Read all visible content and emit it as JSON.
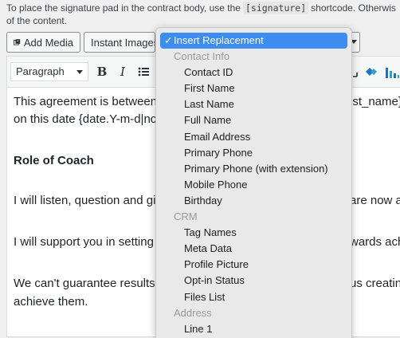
{
  "hint": {
    "before": "To place the signature pad in the contract body, use the",
    "code": "[signature]",
    "after": "shortcode. Otherwis",
    "line2": "of the content."
  },
  "buttons": {
    "add_media": "Add Media",
    "instant_images": "Instant Images"
  },
  "toolbar": {
    "format": "Paragraph",
    "bold": "B",
    "italic": "I",
    "list": "☰"
  },
  "content": {
    "p1_left": "This agreement is between",
    "p1_right": "ist_name}",
    "p1_line2": "on this date {date.Y-m-d|nc",
    "heading": "Role of Coach",
    "p2_left": "I will listen, question and giv",
    "p2_right": "are now ar",
    "p3_left": "I will support you in setting",
    "p3_right": "wards ach",
    "p4_left": "We can't guarantee results",
    "p4_right": "us creating",
    "p4_line2": "achieve them."
  },
  "dropdown": {
    "selected": "Insert Replacement",
    "check": "✓",
    "items": [
      {
        "label": "Contact Info",
        "group": true
      },
      {
        "label": "Contact ID",
        "group": false
      },
      {
        "label": "First Name",
        "group": false
      },
      {
        "label": "Last Name",
        "group": false
      },
      {
        "label": "Full Name",
        "group": false
      },
      {
        "label": "Email Address",
        "group": false
      },
      {
        "label": "Primary Phone",
        "group": false
      },
      {
        "label": "Primary Phone (with extension)",
        "group": false
      },
      {
        "label": "Mobile Phone",
        "group": false
      },
      {
        "label": "Birthday",
        "group": false
      },
      {
        "label": "CRM",
        "group": true
      },
      {
        "label": "Tag Names",
        "group": false
      },
      {
        "label": "Meta Data",
        "group": false
      },
      {
        "label": "Profile Picture",
        "group": false
      },
      {
        "label": "Opt-in Status",
        "group": false
      },
      {
        "label": "Files List",
        "group": false
      },
      {
        "label": "Address",
        "group": true
      },
      {
        "label": "Line 1",
        "group": false
      }
    ]
  },
  "colors": {
    "accent": "#3d8cf0",
    "group_label": "#9a9a9a"
  }
}
